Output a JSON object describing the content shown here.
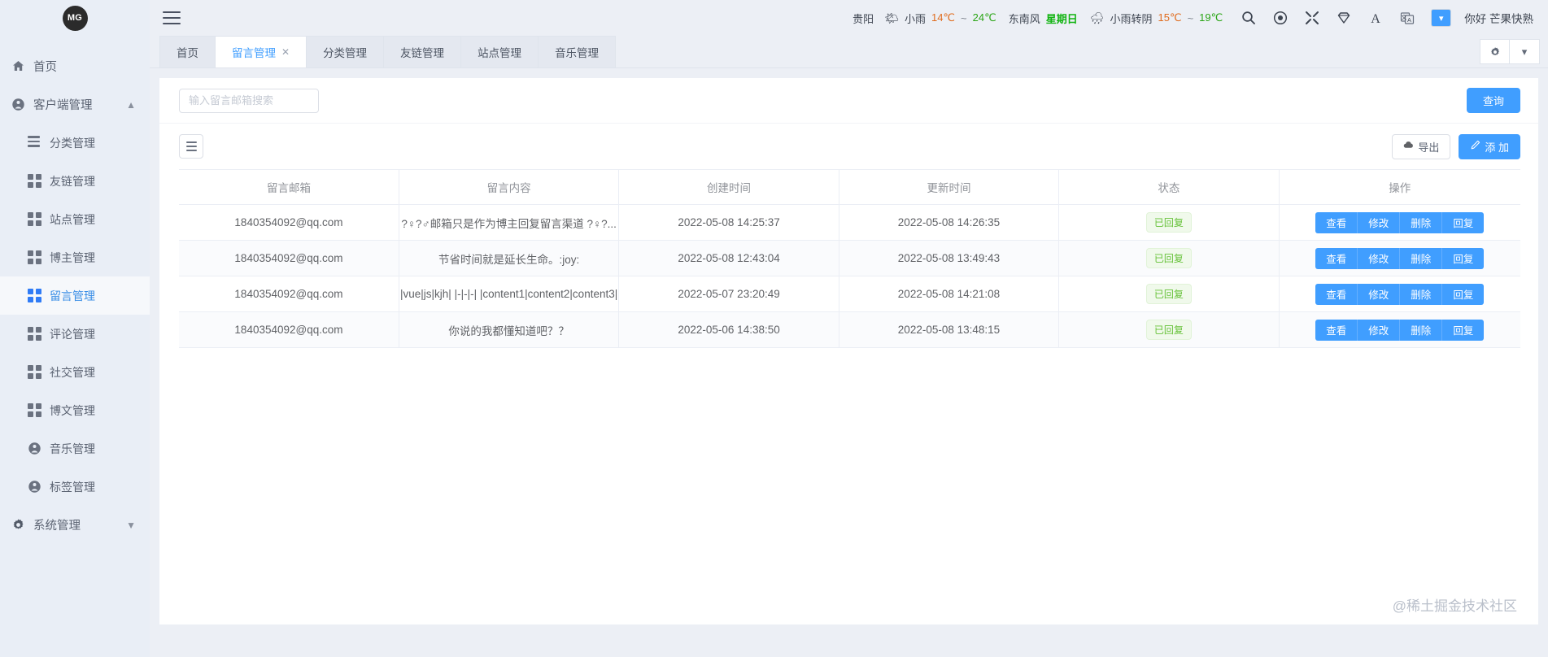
{
  "sidebar": {
    "logo_text": "MG",
    "items": [
      {
        "label": "首页",
        "icon": "home-icon",
        "type": "top",
        "active": false
      },
      {
        "label": "客户端管理",
        "icon": "user-circle-icon",
        "type": "group",
        "expanded": true,
        "chevron": "chevron-up-icon"
      },
      {
        "label": "分类管理",
        "icon": "lines-icon",
        "type": "sub",
        "active": false
      },
      {
        "label": "友链管理",
        "icon": "grid-icon",
        "type": "sub",
        "active": false
      },
      {
        "label": "站点管理",
        "icon": "grid-icon",
        "type": "sub",
        "active": false
      },
      {
        "label": "博主管理",
        "icon": "grid-icon",
        "type": "sub",
        "active": false
      },
      {
        "label": "留言管理",
        "icon": "grid-icon",
        "type": "sub",
        "active": true
      },
      {
        "label": "评论管理",
        "icon": "grid-icon",
        "type": "sub",
        "active": false
      },
      {
        "label": "社交管理",
        "icon": "grid-icon",
        "type": "sub",
        "active": false
      },
      {
        "label": "博文管理",
        "icon": "grid-icon",
        "type": "sub",
        "active": false
      },
      {
        "label": "音乐管理",
        "icon": "user-circle-icon",
        "type": "sub",
        "active": false
      },
      {
        "label": "标签管理",
        "icon": "user-circle-icon",
        "type": "sub",
        "active": false
      },
      {
        "label": "系统管理",
        "icon": "gear-icon",
        "type": "group",
        "expanded": false,
        "chevron": "chevron-down-icon"
      }
    ]
  },
  "header": {
    "menu_icon": "hamburger-icon",
    "weather": {
      "city": "贵阳",
      "today_icon": "sun-cloud-icon",
      "today_condition": "小雨",
      "today_low": "14℃",
      "range_sep": "~",
      "today_high": "24℃",
      "wind": "东南风",
      "weekday": "星期日",
      "tomorrow_icon": "rain-icon",
      "tomorrow_condition": "小雨转阴",
      "tomorrow_low": "15℃",
      "tomorrow_high": "19℃"
    },
    "icons": [
      "search-icon",
      "record-icon",
      "fullscreen-icon",
      "diamond-icon",
      "font-size-icon",
      "translate-icon"
    ],
    "language_toggle": "chevron-down-icon",
    "greeting": "你好 芒果快熟"
  },
  "tabs": {
    "items": [
      {
        "label": "首页",
        "active": false,
        "closable": false
      },
      {
        "label": "留言管理",
        "active": true,
        "closable": true,
        "close_icon": "close-icon"
      },
      {
        "label": "分类管理",
        "active": false,
        "closable": false
      },
      {
        "label": "友链管理",
        "active": false,
        "closable": false
      },
      {
        "label": "站点管理",
        "active": false,
        "closable": false
      },
      {
        "label": "音乐管理",
        "active": false,
        "closable": false
      }
    ],
    "right_buttons": [
      {
        "name": "refresh-settings-button",
        "icon": "gear-icon"
      },
      {
        "name": "tab-dropdown-button",
        "icon": "chevron-down-icon"
      }
    ]
  },
  "search": {
    "placeholder": "输入留言邮箱搜索",
    "value": "",
    "query_label": "查询"
  },
  "toolbar": {
    "menu_icon": "list-menu-icon",
    "export_label": "导出",
    "export_icon": "cloud-download-icon",
    "add_label": "添 加",
    "add_icon": "pencil-icon"
  },
  "table": {
    "columns": [
      "留言邮箱",
      "留言内容",
      "创建时间",
      "更新时间",
      "状态",
      "操作"
    ],
    "action_labels": [
      "查看",
      "修改",
      "删除",
      "回复"
    ],
    "rows": [
      {
        "email": "1840354092@qq.com",
        "content": "?♀?♂邮箱只是作为博主回复留言渠道 ?♀?...",
        "created": "2022-05-08 14:25:37",
        "updated": "2022-05-08 14:26:35",
        "status": "已回复"
      },
      {
        "email": "1840354092@qq.com",
        "content": "节省时间就是延长生命。:joy:",
        "created": "2022-05-08 12:43:04",
        "updated": "2022-05-08 13:49:43",
        "status": "已回复"
      },
      {
        "email": "1840354092@qq.com",
        "content": "|vue|js|kjh| |-|-|-| |content1|content2|content3|",
        "created": "2022-05-07 23:20:49",
        "updated": "2022-05-08 14:21:08",
        "status": "已回复"
      },
      {
        "email": "1840354092@qq.com",
        "content": "你说的我都懂知道吧？？",
        "created": "2022-05-06 14:38:50",
        "updated": "2022-05-08 13:48:15",
        "status": "已回复"
      }
    ]
  },
  "watermark": "@稀土掘金技术社区",
  "colors": {
    "primary": "#409eff",
    "success": "#67c23a",
    "sidebar_bg": "#e9eef6",
    "active_text": "#3a8ee6"
  }
}
